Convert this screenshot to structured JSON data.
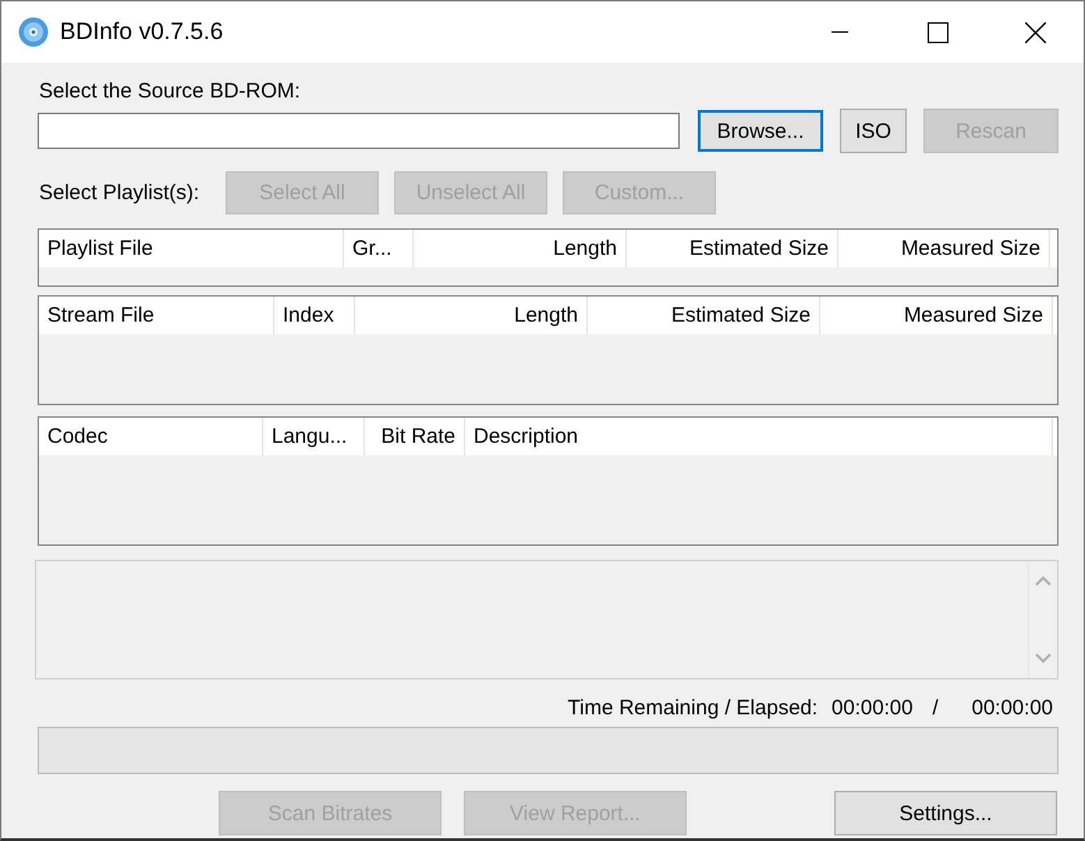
{
  "window": {
    "title": "BDInfo v0.7.5.6"
  },
  "source": {
    "label": "Select the Source BD-ROM:",
    "buttons": [
      {
        "label": "Browse...",
        "disabled": false,
        "focused": true
      },
      {
        "label": "ISO",
        "disabled": false,
        "focused": false
      },
      {
        "label": "Rescan",
        "disabled": true,
        "focused": false
      }
    ]
  },
  "playlist_select": {
    "label": "Select Playlist(s):",
    "buttons": [
      {
        "label": "Select All",
        "disabled": true
      },
      {
        "label": "Unselect All",
        "disabled": true
      },
      {
        "label": "Custom...",
        "disabled": true
      }
    ]
  },
  "tables": [
    {
      "columns": [
        {
          "label": "Playlist File"
        },
        {
          "label": "Gr..."
        },
        {
          "label": "Length"
        },
        {
          "label": "Estimated Size"
        },
        {
          "label": "Measured Size"
        }
      ]
    },
    {
      "columns": [
        {
          "label": "Stream File"
        },
        {
          "label": "Index"
        },
        {
          "label": "Length"
        },
        {
          "label": "Estimated Size"
        },
        {
          "label": "Measured Size"
        }
      ]
    },
    {
      "columns": [
        {
          "label": "Codec"
        },
        {
          "label": "Langu..."
        },
        {
          "label": "Bit Rate"
        },
        {
          "label": "Description"
        }
      ]
    }
  ],
  "time": {
    "label": "Time Remaining / Elapsed:",
    "remaining": "00:00:00",
    "separator": "/",
    "elapsed": "00:00:00"
  },
  "progress": {
    "level": 0
  },
  "bottom_buttons": [
    {
      "label": "Scan Bitrates",
      "disabled": true
    },
    {
      "label": "View Report...",
      "disabled": true
    },
    {
      "label": "Settings...",
      "disabled": false
    }
  ]
}
